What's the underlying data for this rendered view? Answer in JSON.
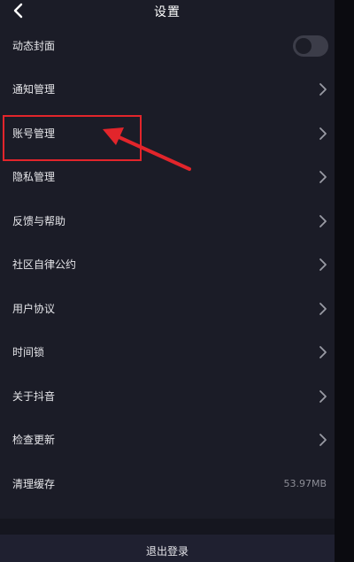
{
  "header": {
    "title": "设置",
    "back_icon": "chevron-left-icon"
  },
  "settings": [
    {
      "label": "动态封面",
      "control": "toggle",
      "enabled": false
    },
    {
      "label": "通知管理",
      "control": "chevron-right-icon"
    },
    {
      "label": "账号管理",
      "control": "chevron-right-icon"
    },
    {
      "label": "隐私管理",
      "control": "chevron-right-icon"
    },
    {
      "label": "反馈与帮助",
      "control": "chevron-right-icon"
    },
    {
      "label": "社区自律公约",
      "control": "chevron-right-icon"
    },
    {
      "label": "用户协议",
      "control": "chevron-right-icon"
    },
    {
      "label": "时间锁",
      "control": "chevron-right-icon"
    },
    {
      "label": "关于抖音",
      "control": "chevron-right-icon"
    },
    {
      "label": "检查更新",
      "control": "chevron-right-icon"
    },
    {
      "label": "清理缓存",
      "value": "53.97MB"
    }
  ],
  "logout": {
    "label": "退出登录"
  },
  "annotation": {
    "highlighted_item": "账号管理",
    "color": "#e2252b"
  },
  "colors": {
    "background": "#1b1c27",
    "text": "#e6e6ea",
    "secondary_text": "#8c8d96"
  }
}
